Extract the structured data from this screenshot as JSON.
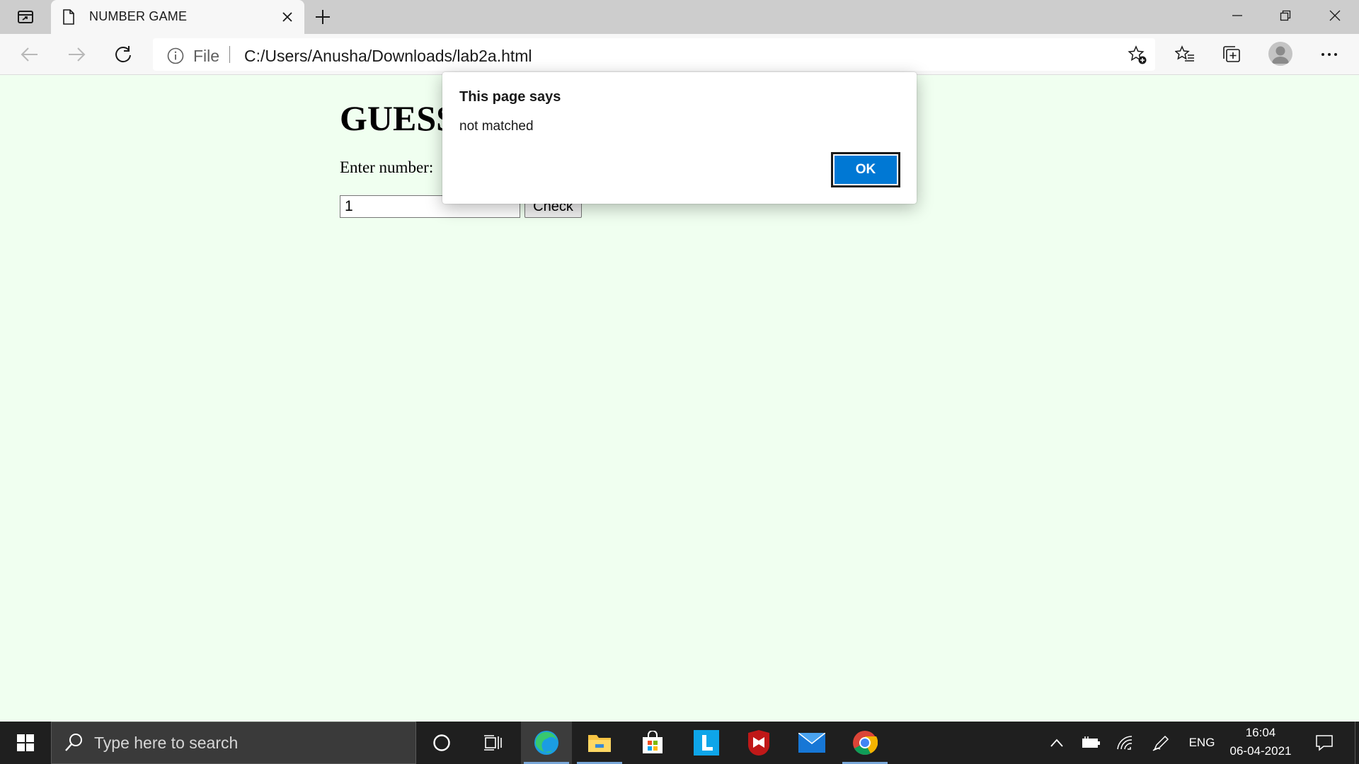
{
  "browser": {
    "tab": {
      "title": "NUMBER GAME"
    },
    "address": {
      "scheme_label": "File",
      "url": "C:/Users/Anusha/Downloads/lab2a.html"
    }
  },
  "page": {
    "heading": "GUESS",
    "input_label": "Enter number:",
    "input_value": "1",
    "check_label": "Check",
    "background_color": "#f0fff0"
  },
  "dialog": {
    "title": "This page says",
    "message": "not matched",
    "ok_label": "OK",
    "ok_color": "#0078d4"
  },
  "taskbar": {
    "search_placeholder": "Type here to search",
    "apps": [
      "cortana-icon",
      "task-view-icon",
      "edge-icon",
      "file-explorer-icon",
      "store-icon",
      "l-app-icon",
      "mcafee-icon",
      "mail-icon",
      "chrome-icon"
    ],
    "active_app": "edge-icon",
    "language": "ENG",
    "time": "16:04",
    "date": "06-04-2021"
  }
}
